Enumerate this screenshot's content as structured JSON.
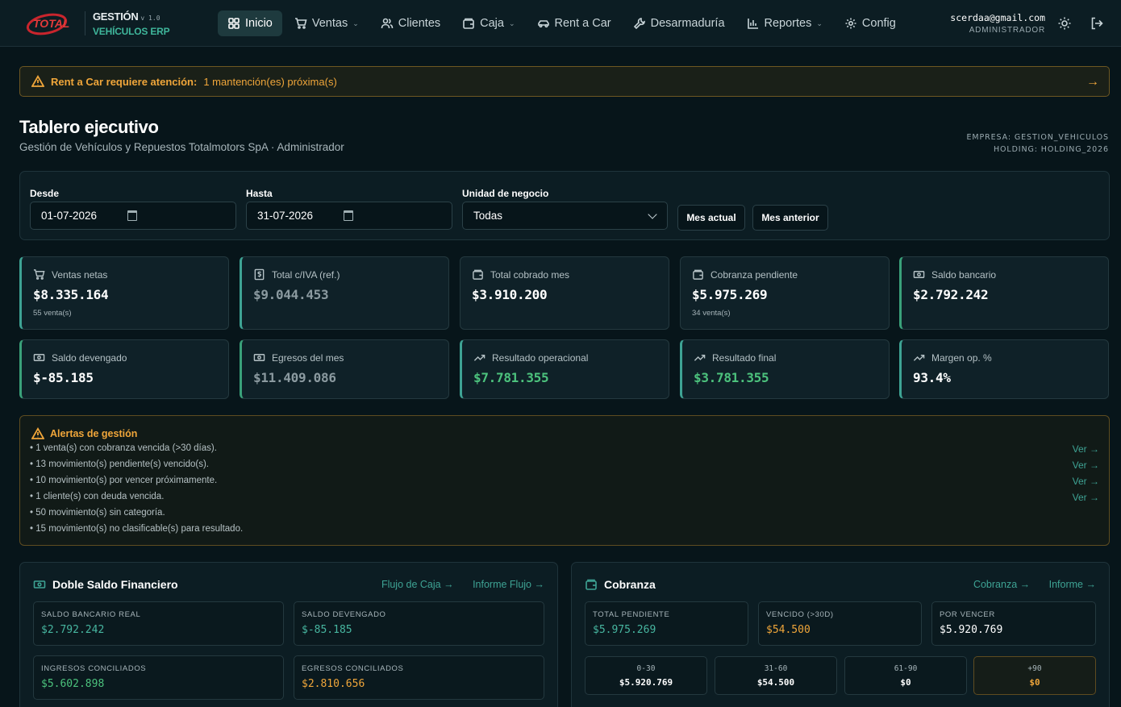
{
  "brand": {
    "title": "GESTIÓN",
    "version": "v 1.0",
    "subtitle": "VEHÍCULOS ERP",
    "logo_text": "TOTAL"
  },
  "nav": {
    "items": [
      {
        "label": "Inicio",
        "icon": "home-grid-icon"
      },
      {
        "label": "Ventas",
        "icon": "cart-icon"
      },
      {
        "label": "Clientes",
        "icon": "users-icon"
      },
      {
        "label": "Caja",
        "icon": "wallet-icon"
      },
      {
        "label": "Rent a Car",
        "icon": "car-icon"
      },
      {
        "label": "Desarmaduría",
        "icon": "wrench-icon"
      },
      {
        "label": "Reportes",
        "icon": "bar-chart-icon"
      },
      {
        "label": "Config",
        "icon": "gear-icon"
      }
    ]
  },
  "user": {
    "email": "scerdaa@gmail.com",
    "role": "ADMINISTRADOR"
  },
  "alert_bar": {
    "label": "Rent a Car requiere atención:",
    "message": "1 mantención(es) próxima(s)"
  },
  "header": {
    "title": "Tablero ejecutivo",
    "subtitle": "Gestión de Vehículos y Repuestos Totalmotors SpA · Administrador",
    "empresa": "EMPRESA: GESTION_VEHICULOS",
    "holding": "HOLDING: HOLDING_2026"
  },
  "filters": {
    "desde_label": "Desde",
    "desde_value": "01-07-2026",
    "hasta_label": "Hasta",
    "hasta_value": "31-07-2026",
    "unidad_label": "Unidad de negocio",
    "unidad_value": "Todas",
    "btn_mes_actual": "Mes actual",
    "btn_mes_anterior": "Mes anterior"
  },
  "kpis": [
    {
      "label": "Ventas netas",
      "value": "$8.335.164",
      "sub": "55 venta(s)",
      "icon": "cart-icon"
    },
    {
      "label": "Total c/IVA (ref.)",
      "value": "$9.044.453",
      "sub": "",
      "icon": "dollar-icon"
    },
    {
      "label": "Total cobrado mes",
      "value": "$3.910.200",
      "sub": "",
      "icon": "wallet-icon"
    },
    {
      "label": "Cobranza pendiente",
      "value": "$5.975.269",
      "sub": "34 venta(s)",
      "icon": "wallet-icon"
    },
    {
      "label": "Saldo bancario",
      "value": "$2.792.242",
      "sub": "",
      "icon": "banknote-icon"
    },
    {
      "label": "Saldo devengado",
      "value": "$-85.185",
      "sub": "",
      "icon": "banknote-icon"
    },
    {
      "label": "Egresos del mes",
      "value": "$11.409.086",
      "sub": "",
      "icon": "banknote-icon"
    },
    {
      "label": "Resultado operacional",
      "value": "$7.781.355",
      "sub": "",
      "icon": "trend-up-icon"
    },
    {
      "label": "Resultado final",
      "value": "$3.781.355",
      "sub": "",
      "icon": "trend-up-icon"
    },
    {
      "label": "Margen op. %",
      "value": "93.4%",
      "sub": "",
      "icon": "trend-up-icon"
    }
  ],
  "alerts": {
    "title": "Alertas de gestión",
    "link_label": "Ver",
    "items": [
      {
        "text": "• 1 venta(s) con cobranza vencida (>30 días).",
        "has_link": true
      },
      {
        "text": "• 13 movimiento(s) pendiente(s) vencido(s).",
        "has_link": true
      },
      {
        "text": "• 10 movimiento(s) por vencer próximamente.",
        "has_link": true
      },
      {
        "text": "• 1 cliente(s) con deuda vencida.",
        "has_link": true
      },
      {
        "text": "• 50 movimiento(s) sin categoría.",
        "has_link": false
      },
      {
        "text": "• 15 movimiento(s) no clasificable(s) para resultado.",
        "has_link": false
      }
    ]
  },
  "doble_saldo": {
    "title": "Doble Saldo Financiero",
    "link1": "Flujo de Caja",
    "link2": "Informe Flujo",
    "cells": [
      {
        "label": "SALDO BANCARIO REAL",
        "value": "$2.792.242"
      },
      {
        "label": "SALDO DEVENGADO",
        "value": "$-85.185"
      },
      {
        "label": "INGRESOS CONCILIADOS",
        "value": "$5.602.898"
      },
      {
        "label": "EGRESOS CONCILIADOS",
        "value": "$2.810.656"
      }
    ]
  },
  "cobranza": {
    "title": "Cobranza",
    "link1": "Cobranza",
    "link2": "Informe",
    "cells": [
      {
        "label": "TOTAL PENDIENTE",
        "value": "$5.975.269"
      },
      {
        "label": "VENCIDO (>30D)",
        "value": "$54.500"
      },
      {
        "label": "POR VENCER",
        "value": "$5.920.769"
      }
    ],
    "aging": [
      {
        "label": "0-30",
        "value": "$5.920.769"
      },
      {
        "label": "31-60",
        "value": "$54.500"
      },
      {
        "label": "61-90",
        "value": "$0"
      },
      {
        "label": "+90",
        "value": "$0"
      }
    ]
  },
  "colors": {
    "accent": "#3ea394",
    "warning": "#f0a63a",
    "positive": "#4cc27d",
    "background": "#07151a"
  }
}
